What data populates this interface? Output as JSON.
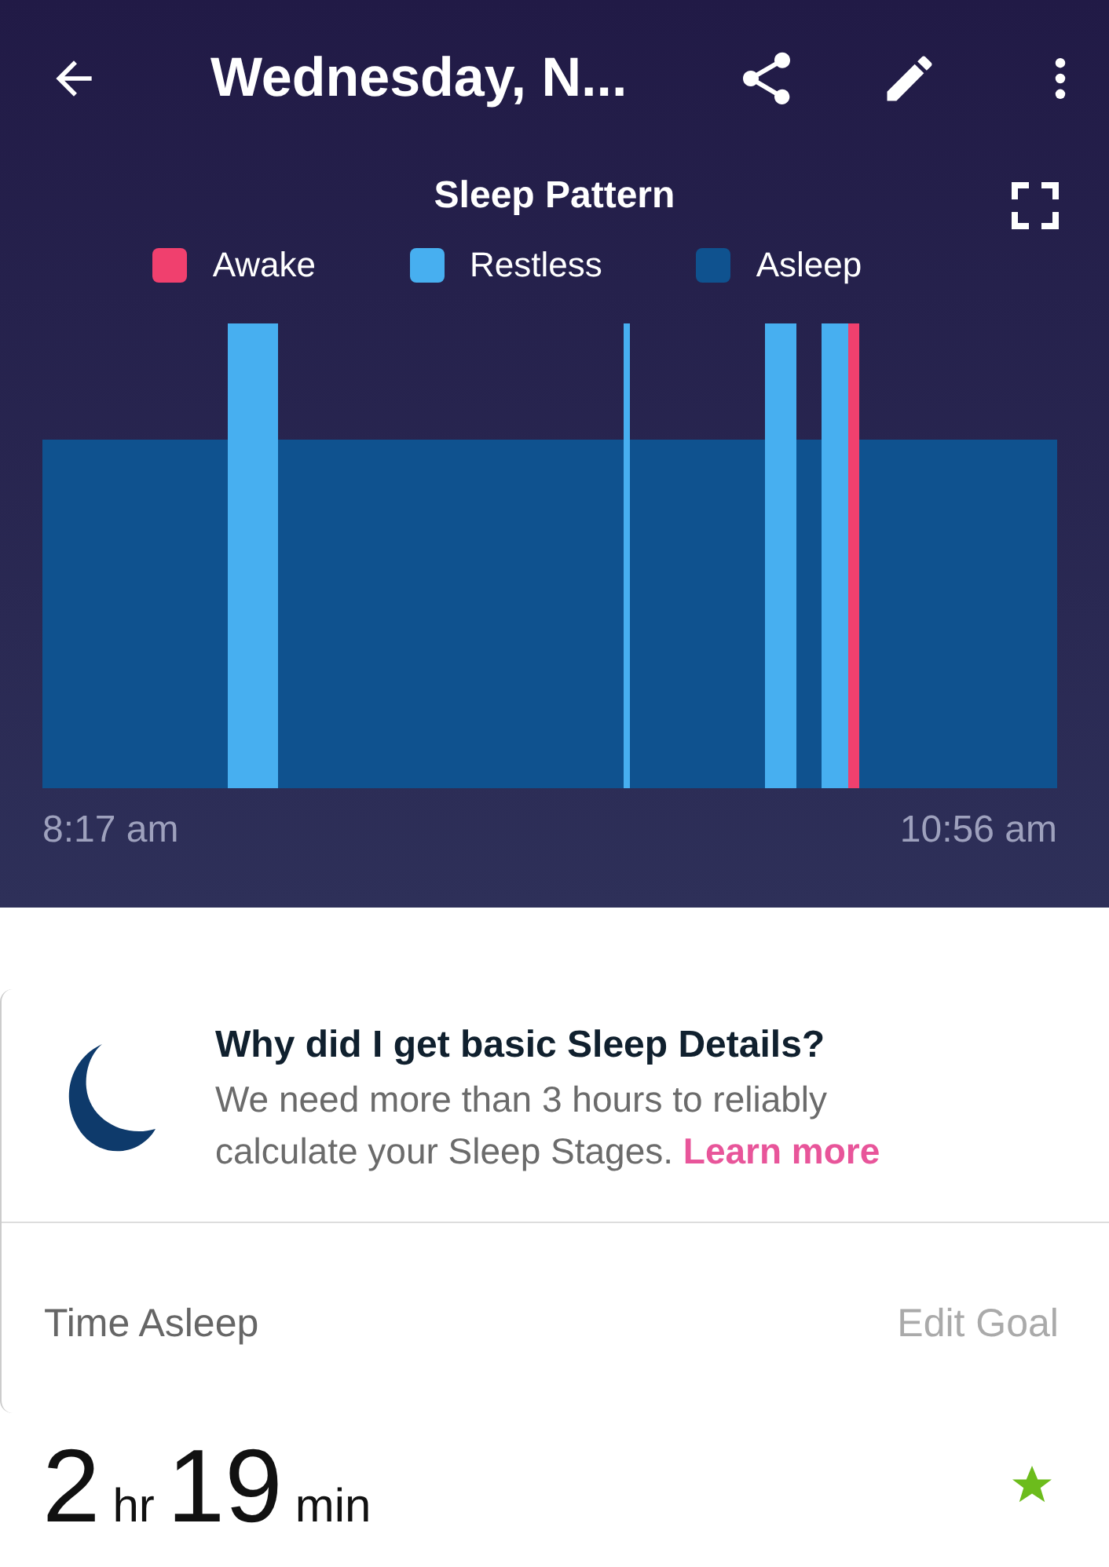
{
  "app_bar": {
    "title": "Wednesday, N..."
  },
  "chart": {
    "title": "Sleep Pattern",
    "legend": [
      {
        "label": "Awake",
        "color": "#f0406e"
      },
      {
        "label": "Restless",
        "color": "#47aff0"
      },
      {
        "label": "Asleep",
        "color": "#0f528f"
      }
    ],
    "start_time": "8:17 am",
    "end_time": "10:56 am"
  },
  "info": {
    "title": "Why did I get basic Sleep Details?",
    "text": "We need more than 3 hours to reliably calculate your Sleep Stages.",
    "link": "Learn more"
  },
  "time_asleep": {
    "label": "Time Asleep",
    "edit": "Edit Goal",
    "hours": "2",
    "hours_unit": "hr",
    "minutes": "19",
    "minutes_unit": "min",
    "goal_met": true
  }
}
